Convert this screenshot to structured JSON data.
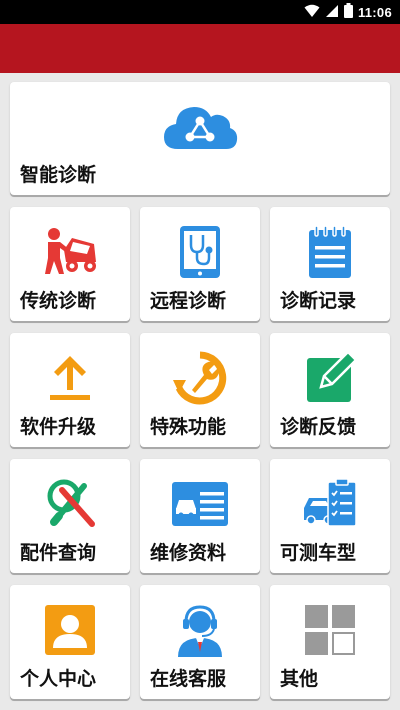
{
  "status_bar": {
    "time": "11:06",
    "icons": [
      "wifi-icon",
      "signal-icon",
      "battery-icon"
    ]
  },
  "colors": {
    "app_bar": "#b5151f",
    "background": "#e9e9e9",
    "icon_blue": "#2d8ee0",
    "icon_red": "#e53935",
    "icon_orange": "#f39c12",
    "icon_green": "#1aa86a",
    "icon_gray": "#9a9a9a"
  },
  "hero": {
    "label": "智能诊断",
    "icon": "cloud-share-icon"
  },
  "grid": [
    {
      "label": "传统诊断",
      "icon": "car-repair-icon"
    },
    {
      "label": "远程诊断",
      "icon": "tablet-stethoscope-icon"
    },
    {
      "label": "诊断记录",
      "icon": "notepad-icon"
    },
    {
      "label": "软件升级",
      "icon": "upload-arrow-icon"
    },
    {
      "label": "特殊功能",
      "icon": "wrench-refresh-icon"
    },
    {
      "label": "诊断反馈",
      "icon": "edit-pencil-icon"
    },
    {
      "label": "配件查询",
      "icon": "search-tools-icon"
    },
    {
      "label": "维修资料",
      "icon": "car-document-icon"
    },
    {
      "label": "可测车型",
      "icon": "car-checklist-icon"
    },
    {
      "label": "个人中心",
      "icon": "user-profile-icon"
    },
    {
      "label": "在线客服",
      "icon": "customer-service-icon"
    },
    {
      "label": "其他",
      "icon": "grid-squares-icon"
    }
  ]
}
